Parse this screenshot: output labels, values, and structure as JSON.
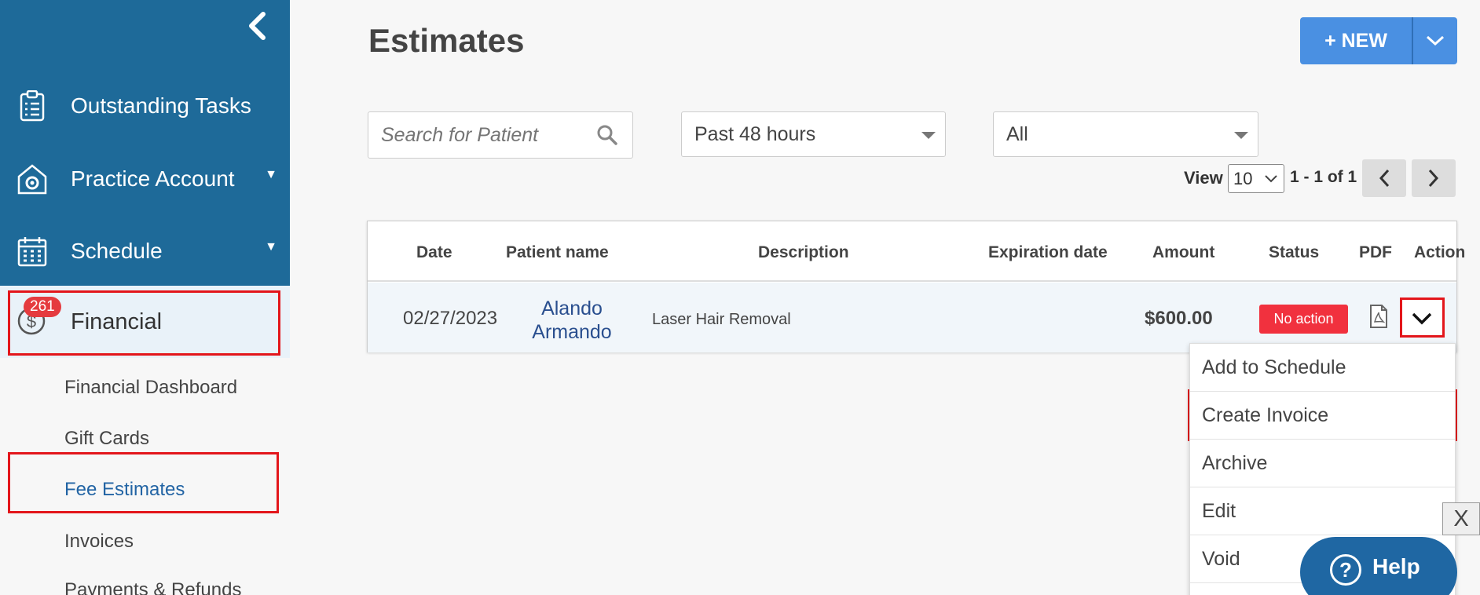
{
  "sidebar": {
    "nav": [
      {
        "label": "Outstanding Tasks",
        "icon": "clipboard-list-icon"
      },
      {
        "label": "Practice Account",
        "icon": "gear-house-icon",
        "caret": "▼"
      },
      {
        "label": "Schedule",
        "icon": "calendar-icon",
        "caret": "▼"
      }
    ],
    "financial": {
      "label": "Financial",
      "badge": "261",
      "icon": "dollar-circle-icon"
    },
    "sub_items": [
      "Financial Dashboard",
      "Gift Cards",
      "Fee Estimates",
      "Invoices",
      "Payments & Refunds"
    ]
  },
  "main": {
    "title": "Estimates",
    "new_button": "+ NEW",
    "search_placeholder": "Search for Patient",
    "date_filter": "Past 48 hours",
    "status_filter": "All",
    "view_label": "View",
    "view_count": "10",
    "range": "1 - 1 of 1"
  },
  "table": {
    "headers": [
      "Date",
      "Patient name",
      "Description",
      "Expiration date",
      "Amount",
      "Status",
      "PDF",
      "Action"
    ],
    "rows": [
      {
        "date": "02/27/2023",
        "patient_first": "Alando",
        "patient_last": "Armando",
        "description": "Laser Hair Removal",
        "expiration": "",
        "amount": "$600.00",
        "status": "No action"
      }
    ]
  },
  "action_menu": [
    "Add to Schedule",
    "Create Invoice",
    "Archive",
    "Edit",
    "Void"
  ],
  "overlay": {
    "close": "X",
    "help": "Help"
  },
  "colors": {
    "sidebar": "#1e6a99",
    "accent": "#4a90e2",
    "status_red": "#f1313e",
    "highlight": "#e3161b"
  }
}
